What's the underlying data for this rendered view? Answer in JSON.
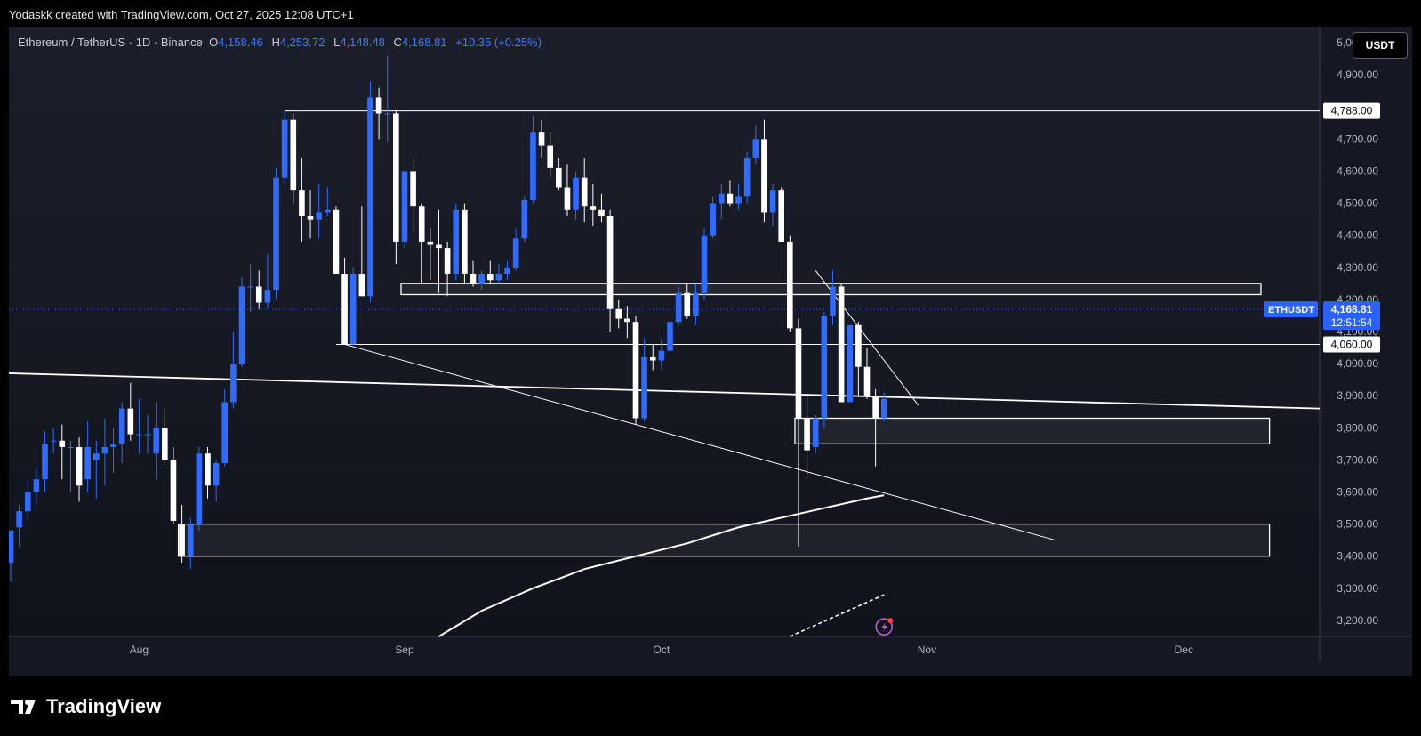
{
  "header": {
    "credit": "Yodaskk created with TradingView.com, Oct 27, 2025 12:08 UTC+1"
  },
  "legend": {
    "symbol": "Ethereum / TetherUS · 1D · Binance",
    "open_label": "O",
    "open": "4,158.46",
    "high_label": "H",
    "high": "4,253.72",
    "low_label": "L",
    "low": "4,148.48",
    "close_label": "C",
    "close": "4,168.81",
    "change": "+10.35 (+0.25%)"
  },
  "unit_button": "USDT",
  "footer": {
    "brand": "TradingView"
  },
  "colors": {
    "background": "#151822",
    "up": "#2f6bff",
    "down": "#ffffff",
    "accent": "#2962ff"
  },
  "chart_data": {
    "type": "candlestick",
    "ylim": [
      3150,
      5050
    ],
    "y_ticks": [
      "5,000.00",
      "4,900.00",
      "4,800.00",
      "4,700.00",
      "4,600.00",
      "4,500.00",
      "4,400.00",
      "4,300.00",
      "4,200.00",
      "4,100.00",
      "4,000.00",
      "3,900.00",
      "3,800.00",
      "3,700.00",
      "3,600.00",
      "3,500.00",
      "3,400.00",
      "3,300.00",
      "3,200.00"
    ],
    "y_tick_values": [
      5000,
      4900,
      4800,
      4700,
      4600,
      4500,
      4400,
      4300,
      4200,
      4100,
      4000,
      3900,
      3800,
      3700,
      3600,
      3500,
      3400,
      3300,
      3200
    ],
    "x_ticks": [
      {
        "label": "Aug",
        "date": "2025-08-01"
      },
      {
        "label": "Sep",
        "date": "2025-09-01"
      },
      {
        "label": "Oct",
        "date": "2025-10-01"
      },
      {
        "label": "Nov",
        "date": "2025-11-01"
      },
      {
        "label": "Dec",
        "date": "2025-12-01"
      }
    ],
    "x_start_date": "2025-07-17",
    "candles": [
      {
        "d": "2025-07-17",
        "o": 3380,
        "h": 3420,
        "l": 3320,
        "c": 3480
      },
      {
        "d": "2025-07-18",
        "o": 3490,
        "h": 3560,
        "l": 3430,
        "c": 3540
      },
      {
        "d": "2025-07-19",
        "o": 3540,
        "h": 3640,
        "l": 3510,
        "c": 3600
      },
      {
        "d": "2025-07-20",
        "o": 3600,
        "h": 3680,
        "l": 3560,
        "c": 3640
      },
      {
        "d": "2025-07-21",
        "o": 3640,
        "h": 3790,
        "l": 3600,
        "c": 3750
      },
      {
        "d": "2025-07-22",
        "o": 3760,
        "h": 3800,
        "l": 3720,
        "c": 3760
      },
      {
        "d": "2025-07-23",
        "o": 3760,
        "h": 3810,
        "l": 3640,
        "c": 3740
      },
      {
        "d": "2025-07-24",
        "o": 3740,
        "h": 3760,
        "l": 3600,
        "c": 3740
      },
      {
        "d": "2025-07-25",
        "o": 3740,
        "h": 3770,
        "l": 3570,
        "c": 3620
      },
      {
        "d": "2025-07-26",
        "o": 3640,
        "h": 3820,
        "l": 3600,
        "c": 3740
      },
      {
        "d": "2025-07-27",
        "o": 3700,
        "h": 3760,
        "l": 3580,
        "c": 3720
      },
      {
        "d": "2025-07-28",
        "o": 3720,
        "h": 3830,
        "l": 3620,
        "c": 3740
      },
      {
        "d": "2025-07-29",
        "o": 3740,
        "h": 3800,
        "l": 3660,
        "c": 3750
      },
      {
        "d": "2025-07-30",
        "o": 3750,
        "h": 3880,
        "l": 3690,
        "c": 3860
      },
      {
        "d": "2025-07-31",
        "o": 3860,
        "h": 3940,
        "l": 3760,
        "c": 3780
      },
      {
        "d": "2025-08-01",
        "o": 3780,
        "h": 3890,
        "l": 3720,
        "c": 3780
      },
      {
        "d": "2025-08-02",
        "o": 3780,
        "h": 3840,
        "l": 3720,
        "c": 3780
      },
      {
        "d": "2025-08-03",
        "o": 3720,
        "h": 3880,
        "l": 3640,
        "c": 3800
      },
      {
        "d": "2025-08-04",
        "o": 3800,
        "h": 3860,
        "l": 3690,
        "c": 3700
      },
      {
        "d": "2025-08-05",
        "o": 3700,
        "h": 3740,
        "l": 3500,
        "c": 3510
      },
      {
        "d": "2025-08-06",
        "o": 3500,
        "h": 3560,
        "l": 3380,
        "c": 3400
      },
      {
        "d": "2025-08-07",
        "o": 3400,
        "h": 3520,
        "l": 3360,
        "c": 3500
      },
      {
        "d": "2025-08-08",
        "o": 3500,
        "h": 3740,
        "l": 3480,
        "c": 3720
      },
      {
        "d": "2025-08-09",
        "o": 3720,
        "h": 3740,
        "l": 3580,
        "c": 3620
      },
      {
        "d": "2025-08-10",
        "o": 3620,
        "h": 3700,
        "l": 3570,
        "c": 3690
      },
      {
        "d": "2025-08-11",
        "o": 3690,
        "h": 3920,
        "l": 3680,
        "c": 3880
      },
      {
        "d": "2025-08-12",
        "o": 3880,
        "h": 4100,
        "l": 3860,
        "c": 4000
      },
      {
        "d": "2025-08-13",
        "o": 4000,
        "h": 4270,
        "l": 3990,
        "c": 4240
      },
      {
        "d": "2025-08-14",
        "o": 4240,
        "h": 4310,
        "l": 4160,
        "c": 4240
      },
      {
        "d": "2025-08-15",
        "o": 4240,
        "h": 4290,
        "l": 4170,
        "c": 4190
      },
      {
        "d": "2025-08-16",
        "o": 4190,
        "h": 4340,
        "l": 4170,
        "c": 4230
      },
      {
        "d": "2025-08-17",
        "o": 4230,
        "h": 4610,
        "l": 4200,
        "c": 4580
      },
      {
        "d": "2025-08-18",
        "o": 4580,
        "h": 4790,
        "l": 4560,
        "c": 4760
      },
      {
        "d": "2025-08-19",
        "o": 4760,
        "h": 4780,
        "l": 4500,
        "c": 4540
      },
      {
        "d": "2025-08-20",
        "o": 4540,
        "h": 4640,
        "l": 4380,
        "c": 4460
      },
      {
        "d": "2025-08-21",
        "o": 4460,
        "h": 4540,
        "l": 4390,
        "c": 4450
      },
      {
        "d": "2025-08-22",
        "o": 4450,
        "h": 4560,
        "l": 4390,
        "c": 4470
      },
      {
        "d": "2025-08-23",
        "o": 4470,
        "h": 4550,
        "l": 4460,
        "c": 4480
      },
      {
        "d": "2025-08-24",
        "o": 4480,
        "h": 4490,
        "l": 4280,
        "c": 4280
      },
      {
        "d": "2025-08-25",
        "o": 4280,
        "h": 4330,
        "l": 4060,
        "c": 4060
      },
      {
        "d": "2025-08-26",
        "o": 4060,
        "h": 4300,
        "l": 4060,
        "c": 4280
      },
      {
        "d": "2025-08-27",
        "o": 4280,
        "h": 4490,
        "l": 4210,
        "c": 4210
      },
      {
        "d": "2025-08-28",
        "o": 4210,
        "h": 4880,
        "l": 4190,
        "c": 4830
      },
      {
        "d": "2025-08-29",
        "o": 4830,
        "h": 4860,
        "l": 4700,
        "c": 4780
      },
      {
        "d": "2025-08-30",
        "o": 4780,
        "h": 4960,
        "l": 4690,
        "c": 4780
      },
      {
        "d": "2025-08-31",
        "o": 4780,
        "h": 4790,
        "l": 4310,
        "c": 4380
      },
      {
        "d": "2025-09-01",
        "o": 4380,
        "h": 4600,
        "l": 4360,
        "c": 4600
      },
      {
        "d": "2025-09-02",
        "o": 4600,
        "h": 4640,
        "l": 4410,
        "c": 4490
      },
      {
        "d": "2025-09-03",
        "o": 4490,
        "h": 4500,
        "l": 4250,
        "c": 4380
      },
      {
        "d": "2025-09-04",
        "o": 4380,
        "h": 4420,
        "l": 4260,
        "c": 4370
      },
      {
        "d": "2025-09-05",
        "o": 4370,
        "h": 4480,
        "l": 4220,
        "c": 4360
      },
      {
        "d": "2025-09-06",
        "o": 4360,
        "h": 4380,
        "l": 4210,
        "c": 4280
      },
      {
        "d": "2025-09-07",
        "o": 4280,
        "h": 4500,
        "l": 4260,
        "c": 4480
      },
      {
        "d": "2025-09-08",
        "o": 4480,
        "h": 4500,
        "l": 4250,
        "c": 4280
      },
      {
        "d": "2025-09-09",
        "o": 4280,
        "h": 4320,
        "l": 4240,
        "c": 4250
      },
      {
        "d": "2025-09-10",
        "o": 4250,
        "h": 4290,
        "l": 4230,
        "c": 4280
      },
      {
        "d": "2025-09-11",
        "o": 4280,
        "h": 4320,
        "l": 4250,
        "c": 4260
      },
      {
        "d": "2025-09-12",
        "o": 4260,
        "h": 4310,
        "l": 4250,
        "c": 4280
      },
      {
        "d": "2025-09-13",
        "o": 4280,
        "h": 4320,
        "l": 4260,
        "c": 4300
      },
      {
        "d": "2025-09-14",
        "o": 4300,
        "h": 4420,
        "l": 4290,
        "c": 4390
      },
      {
        "d": "2025-09-15",
        "o": 4390,
        "h": 4520,
        "l": 4380,
        "c": 4510
      },
      {
        "d": "2025-09-16",
        "o": 4510,
        "h": 4770,
        "l": 4500,
        "c": 4720
      },
      {
        "d": "2025-09-17",
        "o": 4720,
        "h": 4760,
        "l": 4640,
        "c": 4680
      },
      {
        "d": "2025-09-18",
        "o": 4680,
        "h": 4720,
        "l": 4580,
        "c": 4610
      },
      {
        "d": "2025-09-19",
        "o": 4610,
        "h": 4640,
        "l": 4540,
        "c": 4550
      },
      {
        "d": "2025-09-20",
        "o": 4550,
        "h": 4620,
        "l": 4460,
        "c": 4480
      },
      {
        "d": "2025-09-21",
        "o": 4480,
        "h": 4600,
        "l": 4450,
        "c": 4580
      },
      {
        "d": "2025-09-22",
        "o": 4580,
        "h": 4640,
        "l": 4440,
        "c": 4490
      },
      {
        "d": "2025-09-23",
        "o": 4490,
        "h": 4560,
        "l": 4430,
        "c": 4480
      },
      {
        "d": "2025-09-24",
        "o": 4480,
        "h": 4530,
        "l": 4440,
        "c": 4460
      },
      {
        "d": "2025-09-25",
        "o": 4460,
        "h": 4480,
        "l": 4100,
        "c": 4170
      },
      {
        "d": "2025-09-26",
        "o": 4170,
        "h": 4200,
        "l": 4110,
        "c": 4140
      },
      {
        "d": "2025-09-27",
        "o": 4140,
        "h": 4180,
        "l": 4080,
        "c": 4130
      },
      {
        "d": "2025-09-28",
        "o": 4130,
        "h": 4150,
        "l": 3810,
        "c": 3830
      },
      {
        "d": "2025-09-29",
        "o": 3830,
        "h": 4080,
        "l": 3820,
        "c": 4020
      },
      {
        "d": "2025-09-30",
        "o": 4020,
        "h": 4060,
        "l": 3980,
        "c": 4010
      },
      {
        "d": "2025-10-01",
        "o": 4010,
        "h": 4080,
        "l": 3980,
        "c": 4040
      },
      {
        "d": "2025-10-02",
        "o": 4040,
        "h": 4140,
        "l": 4020,
        "c": 4130
      },
      {
        "d": "2025-10-03",
        "o": 4130,
        "h": 4240,
        "l": 4120,
        "c": 4220
      },
      {
        "d": "2025-10-04",
        "o": 4220,
        "h": 4250,
        "l": 4140,
        "c": 4150
      },
      {
        "d": "2025-10-05",
        "o": 4150,
        "h": 4250,
        "l": 4120,
        "c": 4220
      },
      {
        "d": "2025-10-06",
        "o": 4220,
        "h": 4420,
        "l": 4200,
        "c": 4400
      },
      {
        "d": "2025-10-07",
        "o": 4400,
        "h": 4520,
        "l": 4390,
        "c": 4500
      },
      {
        "d": "2025-10-08",
        "o": 4500,
        "h": 4560,
        "l": 4450,
        "c": 4530
      },
      {
        "d": "2025-10-09",
        "o": 4530,
        "h": 4570,
        "l": 4490,
        "c": 4500
      },
      {
        "d": "2025-10-10",
        "o": 4500,
        "h": 4560,
        "l": 4480,
        "c": 4520
      },
      {
        "d": "2025-10-11",
        "o": 4520,
        "h": 4660,
        "l": 4500,
        "c": 4640
      },
      {
        "d": "2025-10-12",
        "o": 4640,
        "h": 4740,
        "l": 4620,
        "c": 4700
      },
      {
        "d": "2025-10-13",
        "o": 4700,
        "h": 4760,
        "l": 4440,
        "c": 4470
      },
      {
        "d": "2025-10-14",
        "o": 4470,
        "h": 4560,
        "l": 4430,
        "c": 4540
      },
      {
        "d": "2025-10-15",
        "o": 4540,
        "h": 4550,
        "l": 4380,
        "c": 4380
      },
      {
        "d": "2025-10-16",
        "o": 4380,
        "h": 4400,
        "l": 4100,
        "c": 4110
      },
      {
        "d": "2025-10-17",
        "o": 4110,
        "h": 4140,
        "l": 3430,
        "c": 3830
      },
      {
        "d": "2025-10-18",
        "o": 3830,
        "h": 3910,
        "l": 3640,
        "c": 3730
      },
      {
        "d": "2025-10-19",
        "o": 3740,
        "h": 3840,
        "l": 3720,
        "c": 3830
      },
      {
        "d": "2025-10-20",
        "o": 3830,
        "h": 4160,
        "l": 3800,
        "c": 4150
      },
      {
        "d": "2025-10-21",
        "o": 4150,
        "h": 4290,
        "l": 4120,
        "c": 4240
      },
      {
        "d": "2025-10-22",
        "o": 4240,
        "h": 4250,
        "l": 3880,
        "c": 3880
      },
      {
        "d": "2025-10-23",
        "o": 3880,
        "h": 4120,
        "l": 3880,
        "c": 4120
      },
      {
        "d": "2025-10-24",
        "o": 4120,
        "h": 4130,
        "l": 3900,
        "c": 3990
      },
      {
        "d": "2025-10-25",
        "o": 3990,
        "h": 4050,
        "l": 3890,
        "c": 3900
      },
      {
        "d": "2025-10-26",
        "o": 3900,
        "h": 3920,
        "l": 3680,
        "c": 3830
      },
      {
        "d": "2025-10-27",
        "o": 3830,
        "h": 3910,
        "l": 3820,
        "c": 3890
      }
    ]
  },
  "price_tags": {
    "resistance_top": "4,788.00",
    "support_mid": "4,060.00",
    "ticker": "ETHUSDT",
    "last_price": "4,168.81",
    "countdown": "12:51:54"
  }
}
